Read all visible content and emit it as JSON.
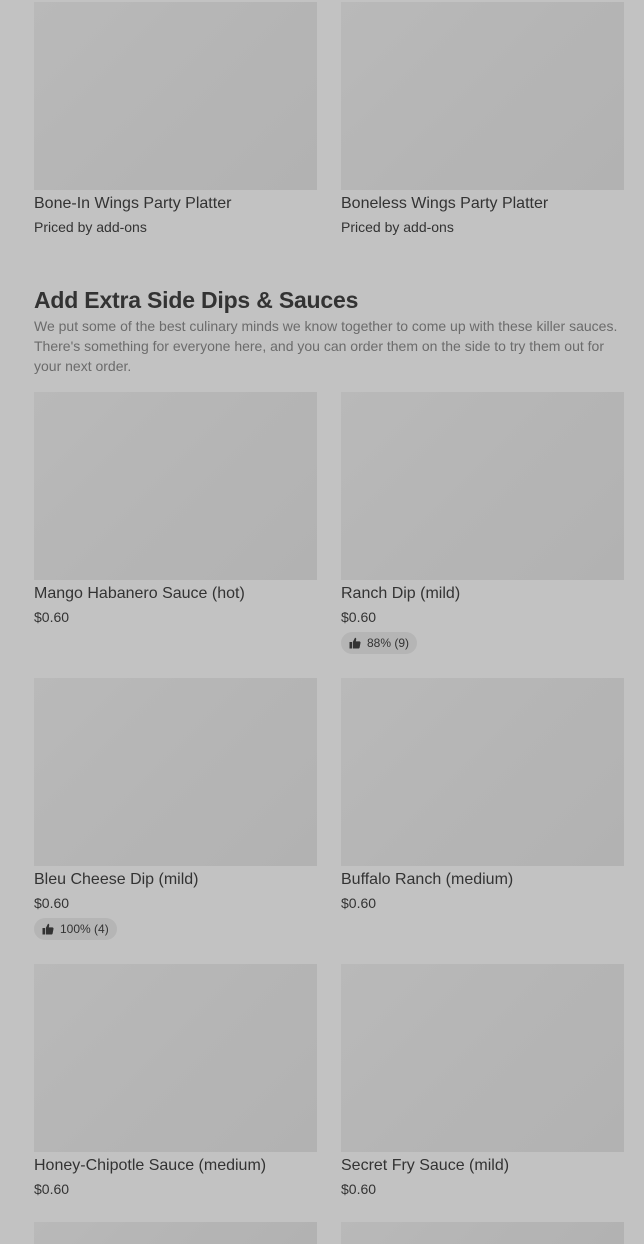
{
  "platters": [
    {
      "name": "Bone-In Wings Party Platter",
      "price": "Priced by add-ons"
    },
    {
      "name": "Boneless Wings Party Platter",
      "price": "Priced by add-ons"
    }
  ],
  "section": {
    "title": "Add Extra Side Dips & Sauces",
    "description": "We put some of the best culinary minds we know together to come up with these killer sauces. There's something for everyone here, and you can order them on the side to try them out for your next order."
  },
  "items": [
    {
      "name": "Mango Habanero Sauce (hot)",
      "price": "$0.60",
      "rating": ""
    },
    {
      "name": "Ranch Dip (mild)",
      "price": "$0.60",
      "rating": "88% (9)"
    },
    {
      "name": "Bleu Cheese Dip (mild)",
      "price": "$0.60",
      "rating": "100% (4)"
    },
    {
      "name": "Buffalo Ranch (medium)",
      "price": "$0.60",
      "rating": ""
    },
    {
      "name": "Honey-Chipotle Sauce (medium)",
      "price": "$0.60",
      "rating": ""
    },
    {
      "name": "Secret Fry Sauce (mild)",
      "price": "$0.60",
      "rating": ""
    }
  ],
  "icons": {
    "rating": "thumbs-up-icon"
  },
  "colors": {
    "background": "#c2c2c2",
    "text": "#333333",
    "muted_text": "#6b6b6b",
    "image_placeholder": "#b7b7b7"
  }
}
